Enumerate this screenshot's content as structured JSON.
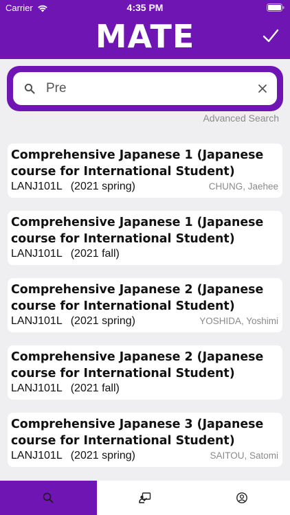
{
  "status_bar": {
    "carrier": "Carrier",
    "time": "4:35 PM",
    "icons": [
      "wifi-icon",
      "battery-icon"
    ]
  },
  "header": {
    "title": "MATE",
    "done_icon": "checkmark-icon"
  },
  "search": {
    "value": "Pre",
    "icon": "search-icon",
    "clear_icon": "clear-icon",
    "advanced_label": "Advanced Search"
  },
  "courses": [
    {
      "title": "Comprehensive Japanese 1 (Japanese course for International Student)",
      "code": "LANJ101L",
      "term": "(2021 spring)",
      "instructor": "CHUNG, Jaehee"
    },
    {
      "title": "Comprehensive Japanese 1 (Japanese course for International Student)",
      "code": "LANJ101L",
      "term": "(2021 fall)",
      "instructor": ""
    },
    {
      "title": "Comprehensive Japanese 2 (Japanese course for International Student)",
      "code": "LANJ101L",
      "term": "(2021 spring)",
      "instructor": "YOSHIDA, Yoshimi"
    },
    {
      "title": "Comprehensive Japanese 2 (Japanese course for International Student)",
      "code": "LANJ101L",
      "term": "(2021 fall)",
      "instructor": ""
    },
    {
      "title": "Comprehensive Japanese 3 (Japanese course for International Student)",
      "code": "LANJ101L",
      "term": "(2021 spring)",
      "instructor": "SAITOU, Satomi"
    }
  ],
  "tab_bar": {
    "tabs": [
      {
        "icon": "search-icon",
        "active": true
      },
      {
        "icon": "teacher-board-icon",
        "active": false
      },
      {
        "icon": "profile-icon",
        "active": false
      }
    ]
  },
  "colors": {
    "accent": "#6f15b3",
    "background": "#efeff1",
    "card": "#ffffff",
    "muted_text": "#8a8a8a"
  }
}
